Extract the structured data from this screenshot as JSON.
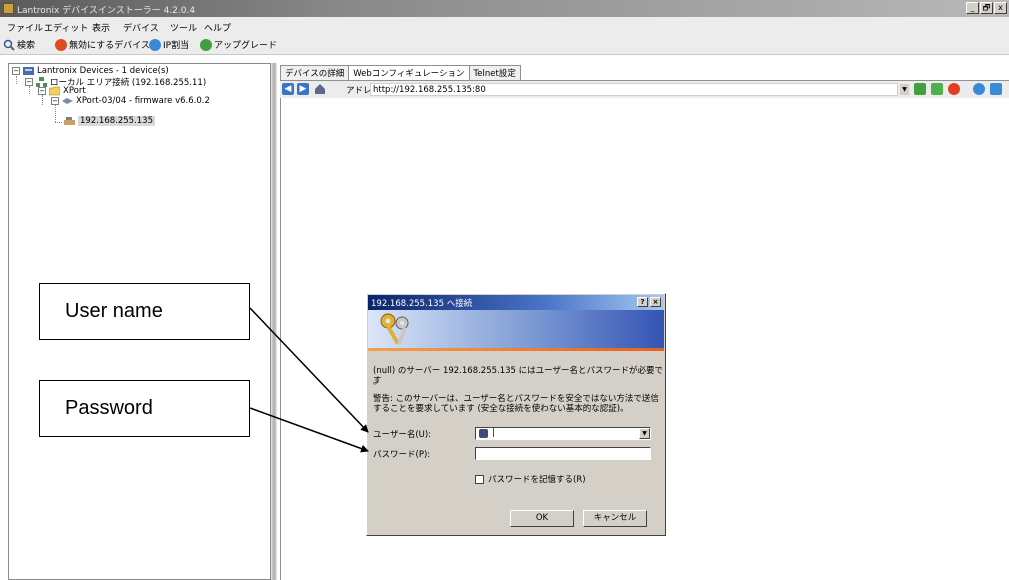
{
  "window": {
    "title": "Lantronix デバイスインストーラー 4.2.0.4",
    "controls": [
      "_",
      "🗗",
      "x"
    ]
  },
  "menu": [
    "ファイル",
    "エディット",
    "表示",
    "デバイス",
    "ツール",
    "ヘルプ"
  ],
  "toolbar": {
    "search": "検索",
    "disable_device": "無効にするデバイス",
    "ip_assign": "IP割当",
    "upgrade": "アップグレード"
  },
  "tree": {
    "root": "Lantronix Devices - 1 device(s)",
    "connection": "ローカル エリア接続 (192.168.255.11)",
    "group": "XPort",
    "device_type": "XPort-03/04 - firmware v6.6.0.2",
    "device_ip": "192.168.255.135"
  },
  "tabs": [
    "デバイスの詳細",
    "Webコンフィギュレーション",
    "Telnet設定"
  ],
  "address_bar": {
    "label": "アドレス",
    "url": "http://192.168.255.135:80"
  },
  "dialog": {
    "title": "192.168.255.135 へ接続",
    "help_btn": "?",
    "close_btn": "×",
    "message": "(null) のサーバー 192.168.255.135 にはユーザー名とパスワードが必要です",
    "message_cont": "。",
    "warning_line1": "警告: このサーバーは、ユーザー名とパスワードを安全ではない方法で送信",
    "warning_line2": "することを要求しています (安全な接続を使わない基本的な認証)。",
    "username_label": "ユーザー名(U):",
    "username_value": "|",
    "password_label": "パスワード(P):",
    "password_value": "",
    "remember_label": "パスワードを記憶する(R)",
    "ok": "OK",
    "cancel": "キャンセル"
  },
  "callouts": {
    "username": "User name",
    "password": "Password"
  },
  "colors": {
    "dialog_titlebar": "#0a246a",
    "nav_button": "#3a74c8",
    "face": "#d4d0c8"
  }
}
